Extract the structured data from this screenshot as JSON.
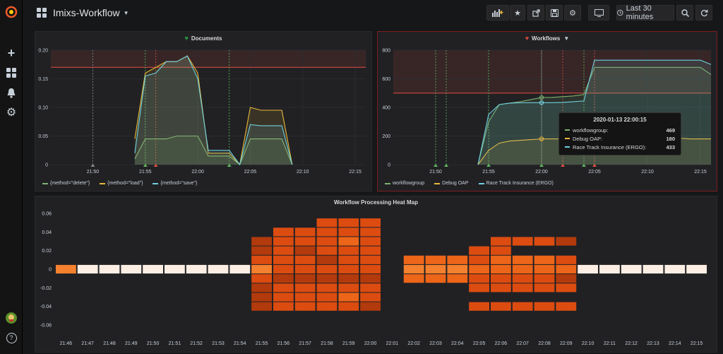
{
  "app": {
    "dashboard_title": "Imixs-Workflow",
    "time_range_label": "Last 30 minutes"
  },
  "sidebar": {
    "items": [
      {
        "icon": "grafana-logo-icon"
      },
      {
        "icon": "plus-icon",
        "glyph": "+"
      },
      {
        "icon": "dashboards-icon"
      },
      {
        "icon": "bell-icon",
        "glyph": "🔔"
      },
      {
        "icon": "gear-icon",
        "glyph": "⚙"
      },
      {
        "icon": "avatar"
      },
      {
        "icon": "help-icon",
        "glyph": "?"
      }
    ]
  },
  "toolbar": {
    "add_panel_glyph": "📊",
    "star_glyph": "★",
    "share_glyph": "⤴",
    "save_glyph": "💾",
    "settings_glyph": "⚙",
    "tv_glyph": "🖵",
    "clock_glyph": "🕓",
    "zoom_glyph": "🔍",
    "refresh_glyph": "⟳"
  },
  "colors": {
    "green": "#7eb26d",
    "yellow": "#eab839",
    "cyan": "#6ed0e0",
    "alert_red": "#e24d42",
    "heart_green": "#299c46",
    "heart_red": "#d44a3a"
  },
  "documents_panel": {
    "title": "Documents",
    "legend": [
      "{method=\"delete\"}",
      "{method=\"load\"}",
      "{method=\"save\"}"
    ],
    "chart_data": {
      "type": "line",
      "title": "Documents",
      "x_ticks": [
        "21:50",
        "21:55",
        "22:00",
        "22:05",
        "22:10",
        "22:15"
      ],
      "y_ticks": [
        "0",
        "0.05",
        "0.10",
        "0.15",
        "0.20"
      ],
      "ylim": [
        0,
        0.2
      ],
      "threshold": 0.17,
      "series": [
        {
          "name": "{method=\"delete\"}",
          "x": [
            "21:54",
            "21:55",
            "21:56",
            "21:57",
            "21:58",
            "21:59",
            "22:00",
            "22:01",
            "22:02",
            "22:03",
            "22:04",
            "22:05",
            "22:06",
            "22:07",
            "22:08",
            "22:09"
          ],
          "values": [
            0.01,
            0.045,
            0.045,
            0.045,
            0.05,
            0.05,
            0.05,
            0.015,
            0.015,
            0.015,
            0,
            0.045,
            0.045,
            0.045,
            0.045,
            0
          ]
        },
        {
          "name": "{method=\"load\"}",
          "x": [
            "21:54",
            "21:55",
            "21:56",
            "21:57",
            "21:58",
            "21:59",
            "22:00",
            "22:01",
            "22:02",
            "22:03",
            "22:04",
            "22:05",
            "22:06",
            "22:07",
            "22:08",
            "22:09"
          ],
          "values": [
            0.045,
            0.16,
            0.17,
            0.18,
            0.18,
            0.19,
            0.16,
            0.02,
            0.02,
            0.02,
            0,
            0.1,
            0.095,
            0.095,
            0.095,
            0
          ]
        },
        {
          "name": "{method=\"save\"}",
          "x": [
            "21:54",
            "21:55",
            "21:56",
            "21:57",
            "21:58",
            "21:59",
            "22:00",
            "22:01",
            "22:02",
            "22:03",
            "22:04",
            "22:05",
            "22:06",
            "22:07",
            "22:08",
            "22:09"
          ],
          "values": [
            0.02,
            0.155,
            0.16,
            0.18,
            0.18,
            0.19,
            0.15,
            0.025,
            0.025,
            0.025,
            0,
            0.07,
            0.068,
            0.068,
            0.068,
            0
          ]
        }
      ]
    }
  },
  "workflows_panel": {
    "title": "Workflows",
    "legend": [
      "workflowgroup",
      "Debug OAP",
      "Race Track Insurance (ERGO)"
    ],
    "tooltip": {
      "time": "2020-01-13 22:00:15",
      "rows": [
        {
          "label": "workflowgroup:",
          "value": "469"
        },
        {
          "label": "Debug OAP:",
          "value": "180"
        },
        {
          "label": "Race Track Insurance (ERGO):",
          "value": "433"
        }
      ]
    },
    "chart_data": {
      "type": "line",
      "title": "Workflows",
      "x_ticks": [
        "21:50",
        "21:55",
        "22:00",
        "22:05",
        "22:10",
        "22:15"
      ],
      "y_ticks": [
        "0",
        "200",
        "400",
        "600",
        "800"
      ],
      "ylim": [
        0,
        800
      ],
      "threshold": 500,
      "series": [
        {
          "name": "workflowgroup",
          "x": [
            "21:54",
            "21:55",
            "21:56",
            "21:57",
            "21:58",
            "21:59",
            "22:00",
            "22:01",
            "22:02",
            "22:03",
            "22:04",
            "22:05",
            "22:06",
            "22:07",
            "22:08",
            "22:09",
            "22:10",
            "22:11",
            "22:12",
            "22:13",
            "22:14",
            "22:15",
            "22:16"
          ],
          "values": [
            0,
            300,
            420,
            430,
            440,
            455,
            469,
            470,
            475,
            480,
            490,
            680,
            680,
            680,
            680,
            680,
            680,
            680,
            680,
            680,
            680,
            680,
            630
          ]
        },
        {
          "name": "Debug OAP",
          "x": [
            "21:54",
            "21:55",
            "21:56",
            "21:57",
            "21:58",
            "21:59",
            "22:00",
            "22:01",
            "22:02",
            "22:03",
            "22:04",
            "22:05",
            "22:06",
            "22:07",
            "22:08",
            "22:09",
            "22:10",
            "22:11",
            "22:12",
            "22:13",
            "22:14",
            "22:15",
            "22:16"
          ],
          "values": [
            0,
            100,
            150,
            165,
            170,
            175,
            180,
            180,
            180,
            180,
            185,
            185,
            185,
            185,
            185,
            185,
            185,
            185,
            185,
            185,
            180,
            180,
            180
          ]
        },
        {
          "name": "Race Track Insurance (ERGO)",
          "x": [
            "21:54",
            "21:55",
            "21:56",
            "21:57",
            "21:58",
            "21:59",
            "22:00",
            "22:01",
            "22:02",
            "22:03",
            "22:04",
            "22:05",
            "22:06",
            "22:07",
            "22:08",
            "22:09",
            "22:10",
            "22:11",
            "22:12",
            "22:13",
            "22:14",
            "22:15",
            "22:16"
          ],
          "values": [
            0,
            350,
            420,
            430,
            432,
            433,
            433,
            433,
            435,
            440,
            445,
            730,
            730,
            730,
            730,
            730,
            730,
            730,
            730,
            730,
            730,
            730,
            700
          ]
        }
      ]
    }
  },
  "heatmap_panel": {
    "title": "Workflow Processing Heat Map",
    "chart_data": {
      "type": "heatmap",
      "title": "Workflow Processing Heat Map",
      "x_ticks": [
        "21:46",
        "21:47",
        "21:48",
        "21:49",
        "21:50",
        "21:51",
        "21:52",
        "21:53",
        "21:54",
        "21:55",
        "21:56",
        "21:57",
        "21:58",
        "21:59",
        "22:00",
        "22:01",
        "22:02",
        "22:03",
        "22:04",
        "22:05",
        "22:06",
        "22:07",
        "22:08",
        "22:09",
        "22:10",
        "22:11",
        "22:12",
        "22:13",
        "22:14",
        "22:15"
      ],
      "y_ticks": [
        "0.06",
        "0.04",
        "0.02",
        "0",
        "-0.02",
        "-0.04",
        "-0.06"
      ],
      "y_buckets": [
        0.05,
        0.04,
        0.03,
        0.02,
        0.01,
        0,
        -0.01,
        -0.02,
        -0.03,
        -0.04
      ],
      "cells": [
        {
          "x": "21:46",
          "levels": [
            0,
            0,
            0,
            0,
            0,
            4,
            0,
            0,
            0,
            0
          ]
        },
        {
          "x": "21:47",
          "levels": [
            0,
            0,
            0,
            0,
            0,
            1,
            0,
            0,
            0,
            0
          ]
        },
        {
          "x": "21:48",
          "levels": [
            0,
            0,
            0,
            0,
            0,
            1,
            0,
            0,
            0,
            0
          ]
        },
        {
          "x": "21:49",
          "levels": [
            0,
            0,
            0,
            0,
            0,
            1,
            0,
            0,
            0,
            0
          ]
        },
        {
          "x": "21:50",
          "levels": [
            0,
            0,
            0,
            0,
            0,
            1,
            0,
            0,
            0,
            0
          ]
        },
        {
          "x": "21:51",
          "levels": [
            0,
            0,
            0,
            0,
            0,
            1,
            0,
            0,
            0,
            0
          ]
        },
        {
          "x": "21:52",
          "levels": [
            0,
            0,
            0,
            0,
            0,
            1,
            0,
            0,
            0,
            0
          ]
        },
        {
          "x": "21:53",
          "levels": [
            0,
            0,
            0,
            0,
            0,
            1,
            0,
            0,
            0,
            0
          ]
        },
        {
          "x": "21:54",
          "levels": [
            0,
            0,
            0,
            0,
            0,
            1,
            0,
            0,
            0,
            0
          ]
        },
        {
          "x": "21:55",
          "levels": [
            0,
            0,
            7,
            7,
            6,
            4,
            6,
            7,
            7,
            7
          ]
        },
        {
          "x": "21:56",
          "levels": [
            0,
            6,
            6,
            6,
            6,
            6,
            7,
            6,
            6,
            6
          ]
        },
        {
          "x": "21:57",
          "levels": [
            0,
            6,
            6,
            7,
            6,
            6,
            7,
            6,
            6,
            6
          ]
        },
        {
          "x": "21:58",
          "levels": [
            6,
            6,
            6,
            6,
            7,
            6,
            7,
            6,
            6,
            6
          ]
        },
        {
          "x": "21:59",
          "levels": [
            6,
            6,
            5,
            6,
            6,
            6,
            7,
            6,
            5,
            6
          ]
        },
        {
          "x": "22:00",
          "levels": [
            6,
            6,
            6,
            6,
            6,
            6,
            7,
            6,
            6,
            7
          ]
        },
        {
          "x": "22:01",
          "levels": [
            0,
            0,
            0,
            0,
            0,
            0,
            0,
            0,
            0,
            0
          ]
        },
        {
          "x": "22:02",
          "levels": [
            0,
            0,
            0,
            0,
            5,
            4,
            5,
            0,
            0,
            0
          ]
        },
        {
          "x": "22:03",
          "levels": [
            0,
            0,
            0,
            0,
            5,
            4,
            5,
            0,
            0,
            0
          ]
        },
        {
          "x": "22:04",
          "levels": [
            0,
            0,
            0,
            0,
            5,
            4,
            5,
            0,
            0,
            0
          ]
        },
        {
          "x": "22:05",
          "levels": [
            0,
            0,
            0,
            6,
            6,
            5,
            6,
            6,
            0,
            6
          ]
        },
        {
          "x": "22:06",
          "levels": [
            0,
            0,
            6,
            6,
            5,
            5,
            6,
            6,
            0,
            6
          ]
        },
        {
          "x": "22:07",
          "levels": [
            0,
            0,
            6,
            0,
            5,
            5,
            6,
            6,
            0,
            6
          ]
        },
        {
          "x": "22:08",
          "levels": [
            0,
            0,
            6,
            0,
            5,
            5,
            6,
            6,
            0,
            6
          ]
        },
        {
          "x": "22:09",
          "levels": [
            0,
            0,
            7,
            0,
            6,
            5,
            7,
            6,
            0,
            6
          ]
        },
        {
          "x": "22:10",
          "levels": [
            0,
            0,
            0,
            0,
            0,
            1,
            0,
            0,
            0,
            0
          ]
        },
        {
          "x": "22:11",
          "levels": [
            0,
            0,
            0,
            0,
            0,
            1,
            0,
            0,
            0,
            0
          ]
        },
        {
          "x": "22:12",
          "levels": [
            0,
            0,
            0,
            0,
            0,
            1,
            0,
            0,
            0,
            0
          ]
        },
        {
          "x": "22:13",
          "levels": [
            0,
            0,
            0,
            0,
            0,
            1,
            0,
            0,
            0,
            0
          ]
        },
        {
          "x": "22:14",
          "levels": [
            0,
            0,
            0,
            0,
            0,
            1,
            0,
            0,
            0,
            0
          ]
        },
        {
          "x": "22:15",
          "levels": [
            0,
            0,
            0,
            0,
            0,
            1,
            0,
            0,
            0,
            0
          ]
        }
      ]
    }
  }
}
